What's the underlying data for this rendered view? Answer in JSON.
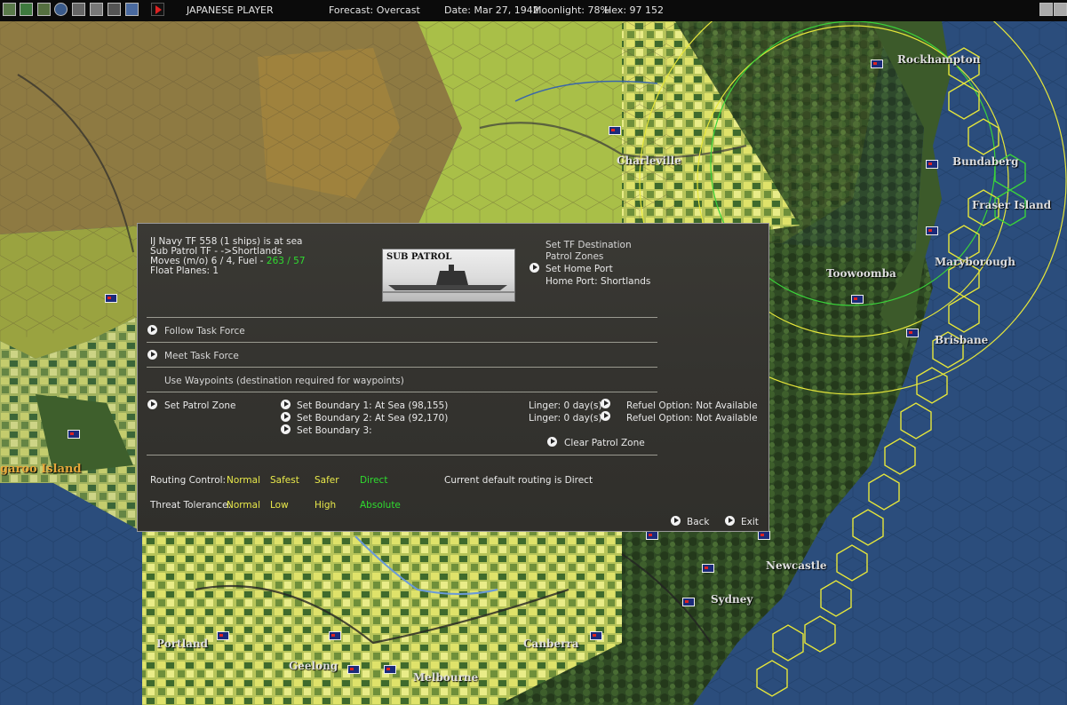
{
  "topbar": {
    "player": "JAPANESE PLAYER",
    "forecast": "Forecast: Overcast",
    "date": "Date: Mar 27, 1942",
    "moonlight": "Moonlight: 78%",
    "hex": "Hex: 97 152"
  },
  "map": {
    "cities": [
      {
        "name": "Rockhampton"
      },
      {
        "name": "Charleville"
      },
      {
        "name": "Bundaberg"
      },
      {
        "name": "Fraser Island"
      },
      {
        "name": "Maryborough"
      },
      {
        "name": "Toowoomba"
      },
      {
        "name": "Brisbane"
      },
      {
        "name": "garoo Island"
      },
      {
        "name": "Newcastle"
      },
      {
        "name": "Sydney"
      },
      {
        "name": "Portland"
      },
      {
        "name": "Canberra"
      },
      {
        "name": "Geelong"
      },
      {
        "name": "Melbourne"
      }
    ]
  },
  "dialog": {
    "info": {
      "line1": "IJ Navy TF 558 (1 ships) is at sea",
      "line2": "Sub Patrol TF - ->Shortlands",
      "moves_prefix": "Moves (m/o) 6 / 4, Fuel - ",
      "fuel": "263 / 57",
      "float_planes": "Float Planes: 1"
    },
    "image_caption": "SUB PATROL",
    "right_menu": {
      "set_tf_destination": "Set TF Destination",
      "patrol_zones": "Patrol Zones",
      "set_home_port": "Set Home Port",
      "home_port": "Home Port: Shortlands"
    },
    "follow_task_force": "Follow Task Force",
    "meet_task_force": "Meet Task Force",
    "use_waypoints": "Use Waypoints   (destination required for waypoints)",
    "set_patrol_zone": "Set Patrol Zone",
    "boundaries": [
      {
        "label": "Set Boundary 1:  At Sea  (98,155)",
        "linger": "Linger: 0 day(s)",
        "refuel": "Refuel Option:  Not Available"
      },
      {
        "label": "Set Boundary 2:  At Sea  (92,170)",
        "linger": "Linger: 0 day(s)",
        "refuel": "Refuel Option:  Not Available"
      },
      {
        "label": "Set Boundary 3:"
      }
    ],
    "clear_patrol_zone": "Clear Patrol Zone",
    "routing": {
      "label": "Routing Control:",
      "options": [
        "Normal",
        "Safest",
        "Safer",
        "Direct"
      ],
      "current": "Current default routing  is Direct"
    },
    "threat": {
      "label": "Threat Tolerance:",
      "options": [
        "Normal",
        "Low",
        "High",
        "Absolute"
      ]
    },
    "back": "Back",
    "exit": "Exit"
  }
}
